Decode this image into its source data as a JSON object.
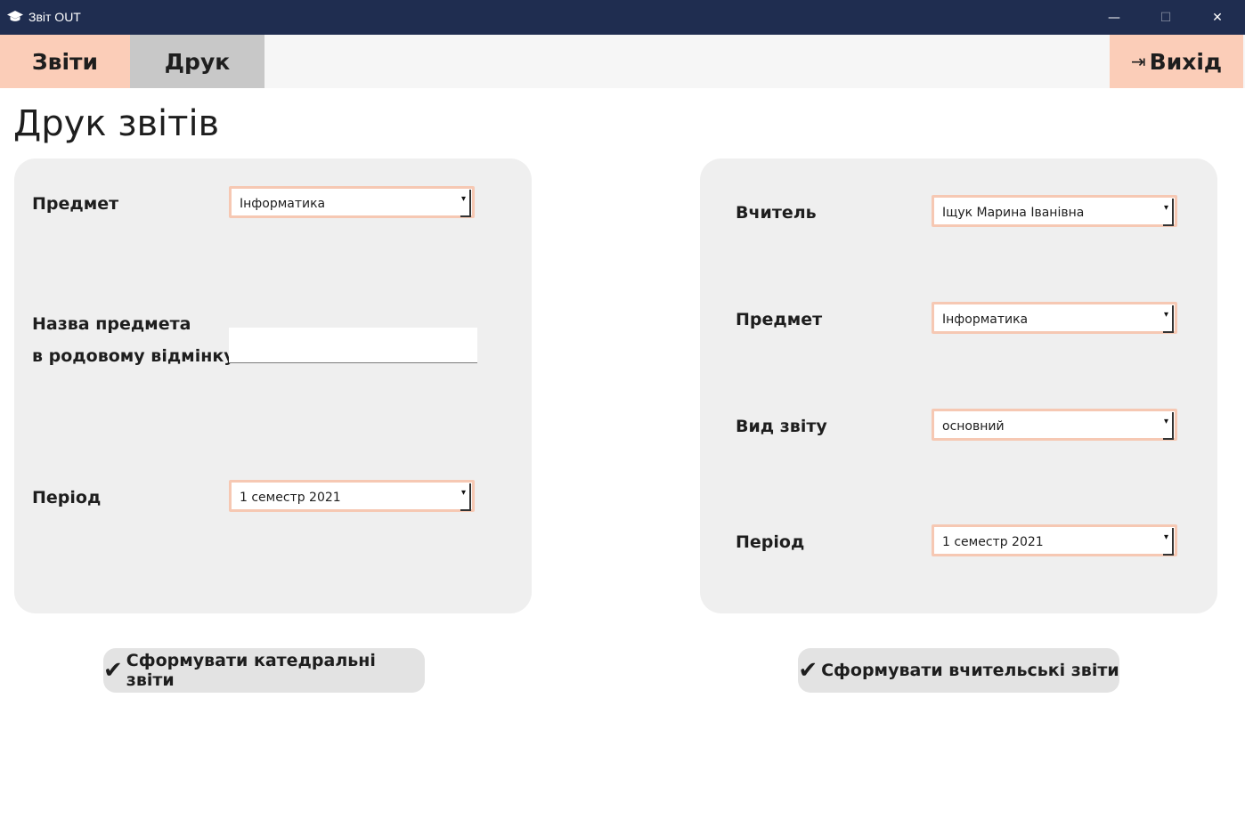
{
  "window": {
    "title": "Звіт OUT",
    "minimize_glyph": "—",
    "maximize_glyph": "☐",
    "close_glyph": "✕",
    "icon": "graduation-cap-icon"
  },
  "nav": {
    "reports": "Звіти",
    "print": "Друк",
    "exit": "Вихід",
    "exit_icon": "⇥"
  },
  "page": {
    "title": "Друк звітів"
  },
  "left_panel": {
    "subject_label": "Предмет",
    "subject_value": "Інформатика",
    "genitive_label_line1": "Назва предмета",
    "genitive_label_line2": "в родовому відмінку",
    "genitive_value": "",
    "period_label": "Період",
    "period_value": "1 семестр 2021"
  },
  "right_panel": {
    "teacher_label": "Вчитель",
    "teacher_value": "Іщук Марина Іванівна",
    "subject_label": "Предмет",
    "subject_value": "Інформатика",
    "report_type_label": "Вид звіту",
    "report_type_value": "основний",
    "period_label": "Період",
    "period_value": "1 семестр 2021"
  },
  "buttons": {
    "check_glyph": "✔",
    "dept_reports": "Сформувати катедральні звіти",
    "teacher_reports": "Сформувати вчительські звіти"
  },
  "colors": {
    "titlebar": "#1f2d50",
    "accent": "#fbcdb8",
    "active_tab": "#c8c8c8",
    "panel": "#efefef"
  }
}
